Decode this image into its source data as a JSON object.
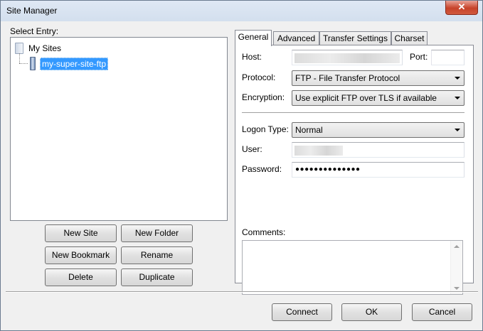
{
  "window": {
    "title": "Site Manager",
    "close_glyph": "✕"
  },
  "select_entry_label": "Select Entry:",
  "tree": {
    "root_label": "My Sites",
    "selected_site": "my-super-site-ftp"
  },
  "left_buttons": {
    "new_site": "New Site",
    "new_folder": "New Folder",
    "new_bookmark": "New Bookmark",
    "rename": "Rename",
    "delete": "Delete",
    "duplicate": "Duplicate"
  },
  "tabs": [
    "General",
    "Advanced",
    "Transfer Settings",
    "Charset"
  ],
  "form": {
    "host_label": "Host:",
    "port_label": "Port:",
    "port_value": "",
    "protocol_label": "Protocol:",
    "protocol_value": "FTP - File Transfer Protocol",
    "encryption_label": "Encryption:",
    "encryption_value": "Use explicit FTP over TLS if available",
    "logon_type_label": "Logon Type:",
    "logon_type_value": "Normal",
    "user_label": "User:",
    "password_label": "Password:",
    "password_value": "●●●●●●●●●●●●●●",
    "comments_label": "Comments:",
    "comments_value": ""
  },
  "footer_buttons": {
    "connect": "Connect",
    "ok": "OK",
    "cancel": "Cancel"
  }
}
